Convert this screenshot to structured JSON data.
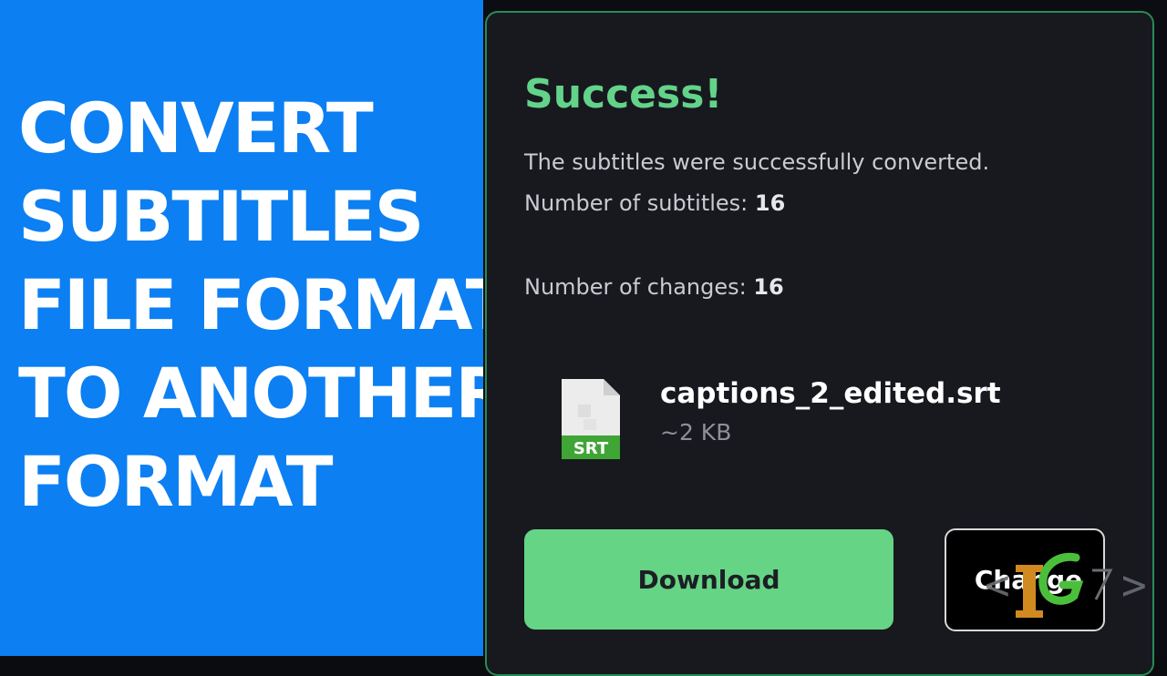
{
  "headline": [
    "CONVERT",
    "SUBTITLES",
    "FILE FORMAT",
    "TO ANOTHER",
    "FORMAT"
  ],
  "result": {
    "title": "Success!",
    "message": "The subtitles were successfully converted.",
    "subtitles_label": "Number of subtitles:",
    "subtitles_count": "16",
    "changes_label": "Number of changes:",
    "changes_count": "16"
  },
  "file": {
    "icon": "srt-file-icon",
    "type_badge": "SRT",
    "name": "captions_2_edited.srt",
    "size": "~2 KB"
  },
  "actions": {
    "download_label": "Download",
    "change_label": "Change"
  },
  "colors": {
    "left_panel": "#0c7ff2",
    "success": "#63d38a",
    "download_button": "#66d485",
    "card_background": "#17191f"
  }
}
